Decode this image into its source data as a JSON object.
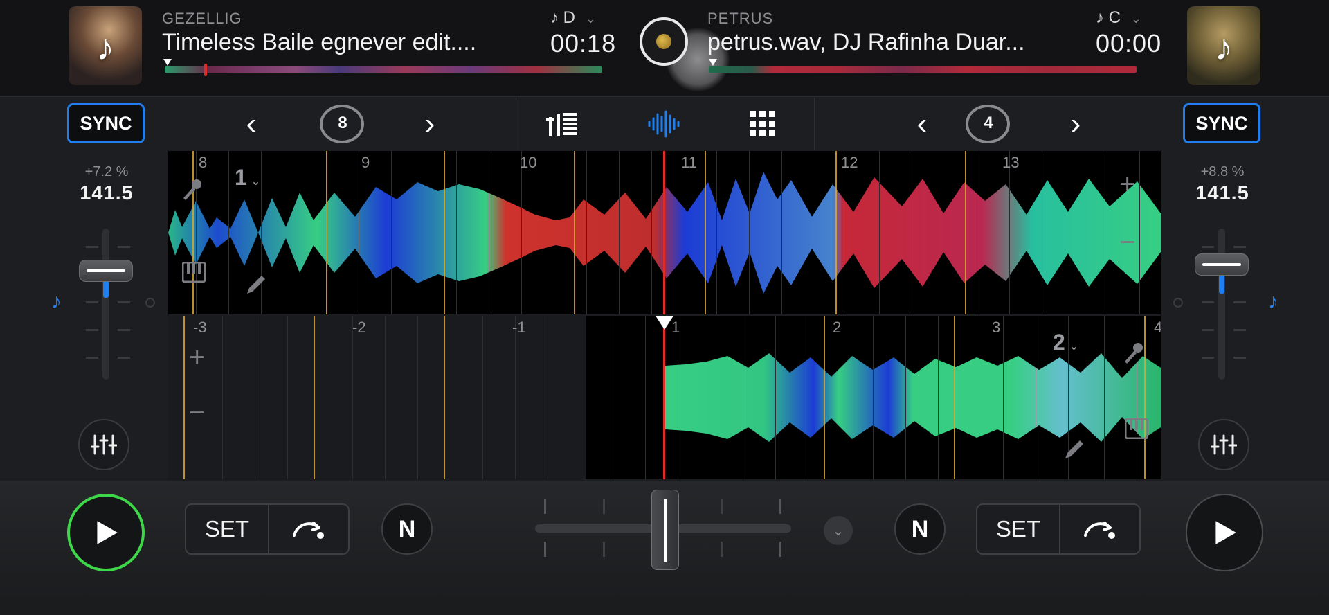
{
  "deck_left": {
    "label": "GEZELLIG",
    "title": "Timeless Baile egnever edit....",
    "key": "D",
    "time": "00:18",
    "pitch": "+7.2 %",
    "bpm": "141.5",
    "sync_label": "SYNC",
    "loop_size": "8",
    "cue_number": "1",
    "bar_numbers": [
      "8",
      "9",
      "10",
      "11",
      "12",
      "13"
    ],
    "set_label": "SET"
  },
  "deck_right": {
    "label": "PETRUS",
    "title": "petrus.wav, DJ Rafinha Duar...",
    "key": "C",
    "time": "00:00",
    "pitch": "+8.8 %",
    "bpm": "141.5",
    "sync_label": "SYNC",
    "loop_size": "4",
    "cue_number": "2",
    "bar_numbers": [
      "-3",
      "-2",
      "-1",
      "1",
      "2",
      "3",
      "4"
    ],
    "set_label": "SET"
  },
  "icons": {
    "album_note": "♪",
    "key_note": "♪",
    "chevron_down": "⌄",
    "chevron_left": "‹",
    "chevron_right": "›",
    "plus": "+",
    "minus": "−",
    "n_button": "N"
  },
  "colors": {
    "accent_blue": "#1f7ff0",
    "play_active": "#3fd74a",
    "playhead_red": "#e02a25",
    "barline_gold": "#d8a832"
  }
}
